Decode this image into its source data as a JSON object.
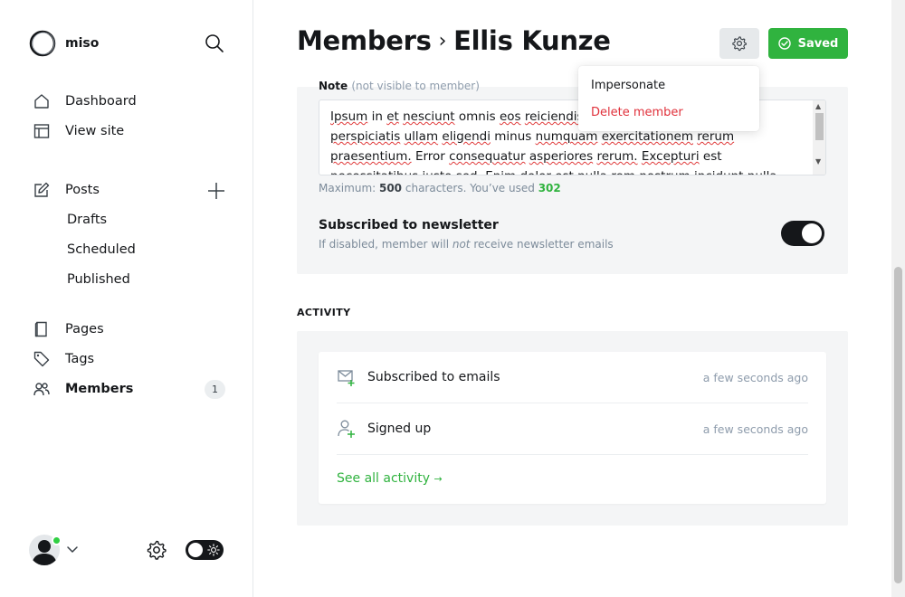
{
  "brand": {
    "name": "miso"
  },
  "sidebar": {
    "primary": [
      {
        "label": "Dashboard",
        "icon": "home-icon"
      },
      {
        "label": "View site",
        "icon": "layout-icon"
      }
    ],
    "posts": {
      "label": "Posts",
      "icon": "edit-icon",
      "sub_items": [
        "Drafts",
        "Scheduled",
        "Published"
      ]
    },
    "secondary": [
      {
        "label": "Pages",
        "icon": "page-icon"
      },
      {
        "label": "Tags",
        "icon": "tag-icon"
      },
      {
        "label": "Members",
        "icon": "members-icon",
        "badge": "1",
        "active": true
      }
    ]
  },
  "header": {
    "section": "Members",
    "separator": "›",
    "name": "Ellis Kunze"
  },
  "toolbar": {
    "saved_label": "Saved"
  },
  "dropdown": {
    "impersonate": "Impersonate",
    "delete": "Delete member"
  },
  "note": {
    "label": "Note",
    "hint": "(not visible to member)",
    "text_lines": [
      "Ipsum in et nesciunt omnis eos reiciendis",
      "perspiciatis ullam eligendi minus numquam exercitationem rerum",
      "praesentium. Error consequatur asperiores rerum. Excepturi est",
      "necessitatibus iusto sed. Enim dolor est nulla rem nostrum incidunt nulla"
    ],
    "count_prefix": "Maximum: ",
    "max": "500",
    "count_mid": " characters. You’ve used ",
    "used": "302"
  },
  "newsletter": {
    "title": "Subscribed to newsletter",
    "desc_prefix": "If disabled, member will ",
    "desc_em": "not",
    "desc_suffix": " receive newsletter emails",
    "enabled": true
  },
  "activity": {
    "heading": "ACTIVITY",
    "items": [
      {
        "label": "Subscribed to emails",
        "time": "a few seconds ago",
        "icon": "email-plus-icon"
      },
      {
        "label": "Signed up",
        "time": "a few seconds ago",
        "icon": "user-plus-icon"
      }
    ],
    "see_all": "See all activity",
    "see_all_arrow": "→"
  },
  "colors": {
    "accent": "#30b33f",
    "danger": "#e0313b",
    "status_online": "#30cf43"
  }
}
